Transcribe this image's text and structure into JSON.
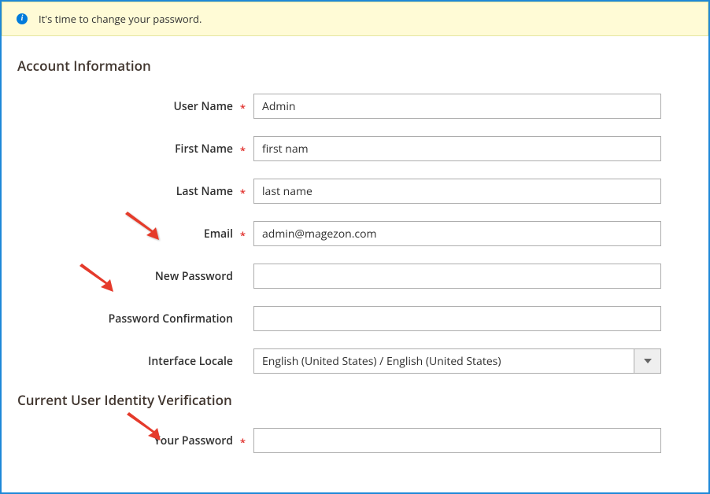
{
  "notice": {
    "text": "It's time to change your password."
  },
  "section1": {
    "title": "Account Information",
    "fields": {
      "username": {
        "label": "User Name",
        "value": "Admin",
        "required": true
      },
      "firstname": {
        "label": "First Name",
        "value": "first nam",
        "required": true
      },
      "lastname": {
        "label": "Last Name",
        "value": "last name",
        "required": true
      },
      "email": {
        "label": "Email",
        "value": "admin@magezon.com",
        "required": true
      },
      "newpassword": {
        "label": "New Password",
        "value": "",
        "required": false
      },
      "passwordconfirm": {
        "label": "Password Confirmation",
        "value": "",
        "required": false
      },
      "locale": {
        "label": "Interface Locale",
        "value": "English (United States) / English (United States)",
        "required": false
      }
    }
  },
  "section2": {
    "title": "Current User Identity Verification",
    "fields": {
      "yourpassword": {
        "label": "Your Password",
        "value": "",
        "required": true
      }
    }
  },
  "required_marker": "*"
}
